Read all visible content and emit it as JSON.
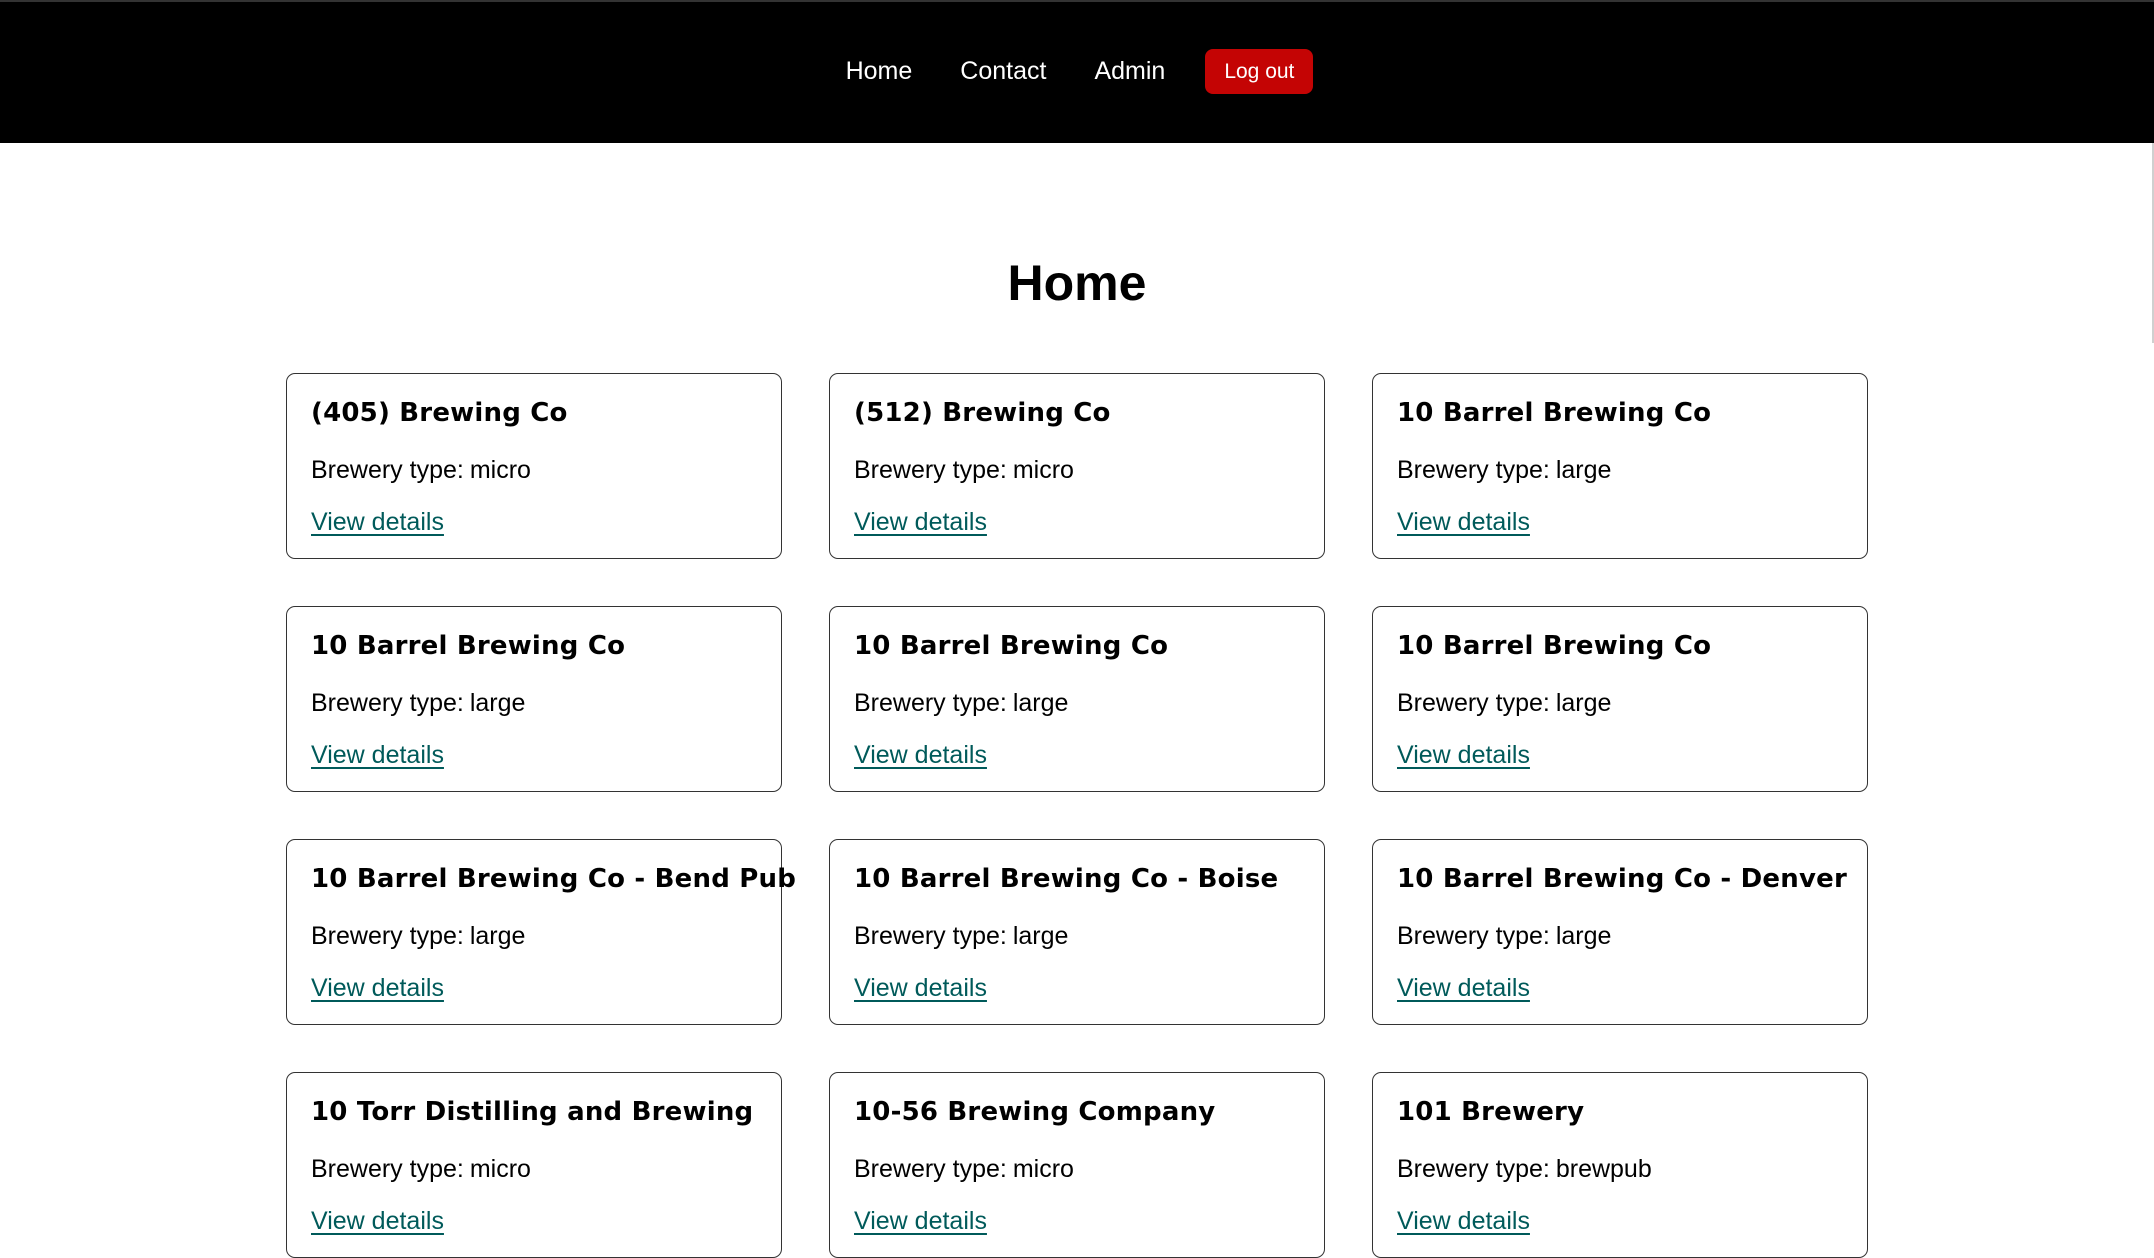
{
  "nav": {
    "links": [
      "Home",
      "Contact",
      "Admin"
    ],
    "logout_label": "Log out",
    "logout_color": "#c40404"
  },
  "page": {
    "title": "Home"
  },
  "type_label": "Brewery type:",
  "view_details_label": "View details",
  "breweries": [
    {
      "name": "(405) Brewing Co",
      "type": "micro"
    },
    {
      "name": "(512) Brewing Co",
      "type": "micro"
    },
    {
      "name": "10 Barrel Brewing Co",
      "type": "large"
    },
    {
      "name": "10 Barrel Brewing Co",
      "type": "large"
    },
    {
      "name": "10 Barrel Brewing Co",
      "type": "large"
    },
    {
      "name": "10 Barrel Brewing Co",
      "type": "large"
    },
    {
      "name": "10 Barrel Brewing Co - Bend Pub",
      "type": "large"
    },
    {
      "name": "10 Barrel Brewing Co - Boise",
      "type": "large"
    },
    {
      "name": "10 Barrel Brewing Co - Denver",
      "type": "large"
    },
    {
      "name": "10 Torr Distilling and Brewing",
      "type": "micro"
    },
    {
      "name": "10-56 Brewing Company",
      "type": "micro"
    },
    {
      "name": "101 Brewery",
      "type": "brewpub"
    }
  ]
}
